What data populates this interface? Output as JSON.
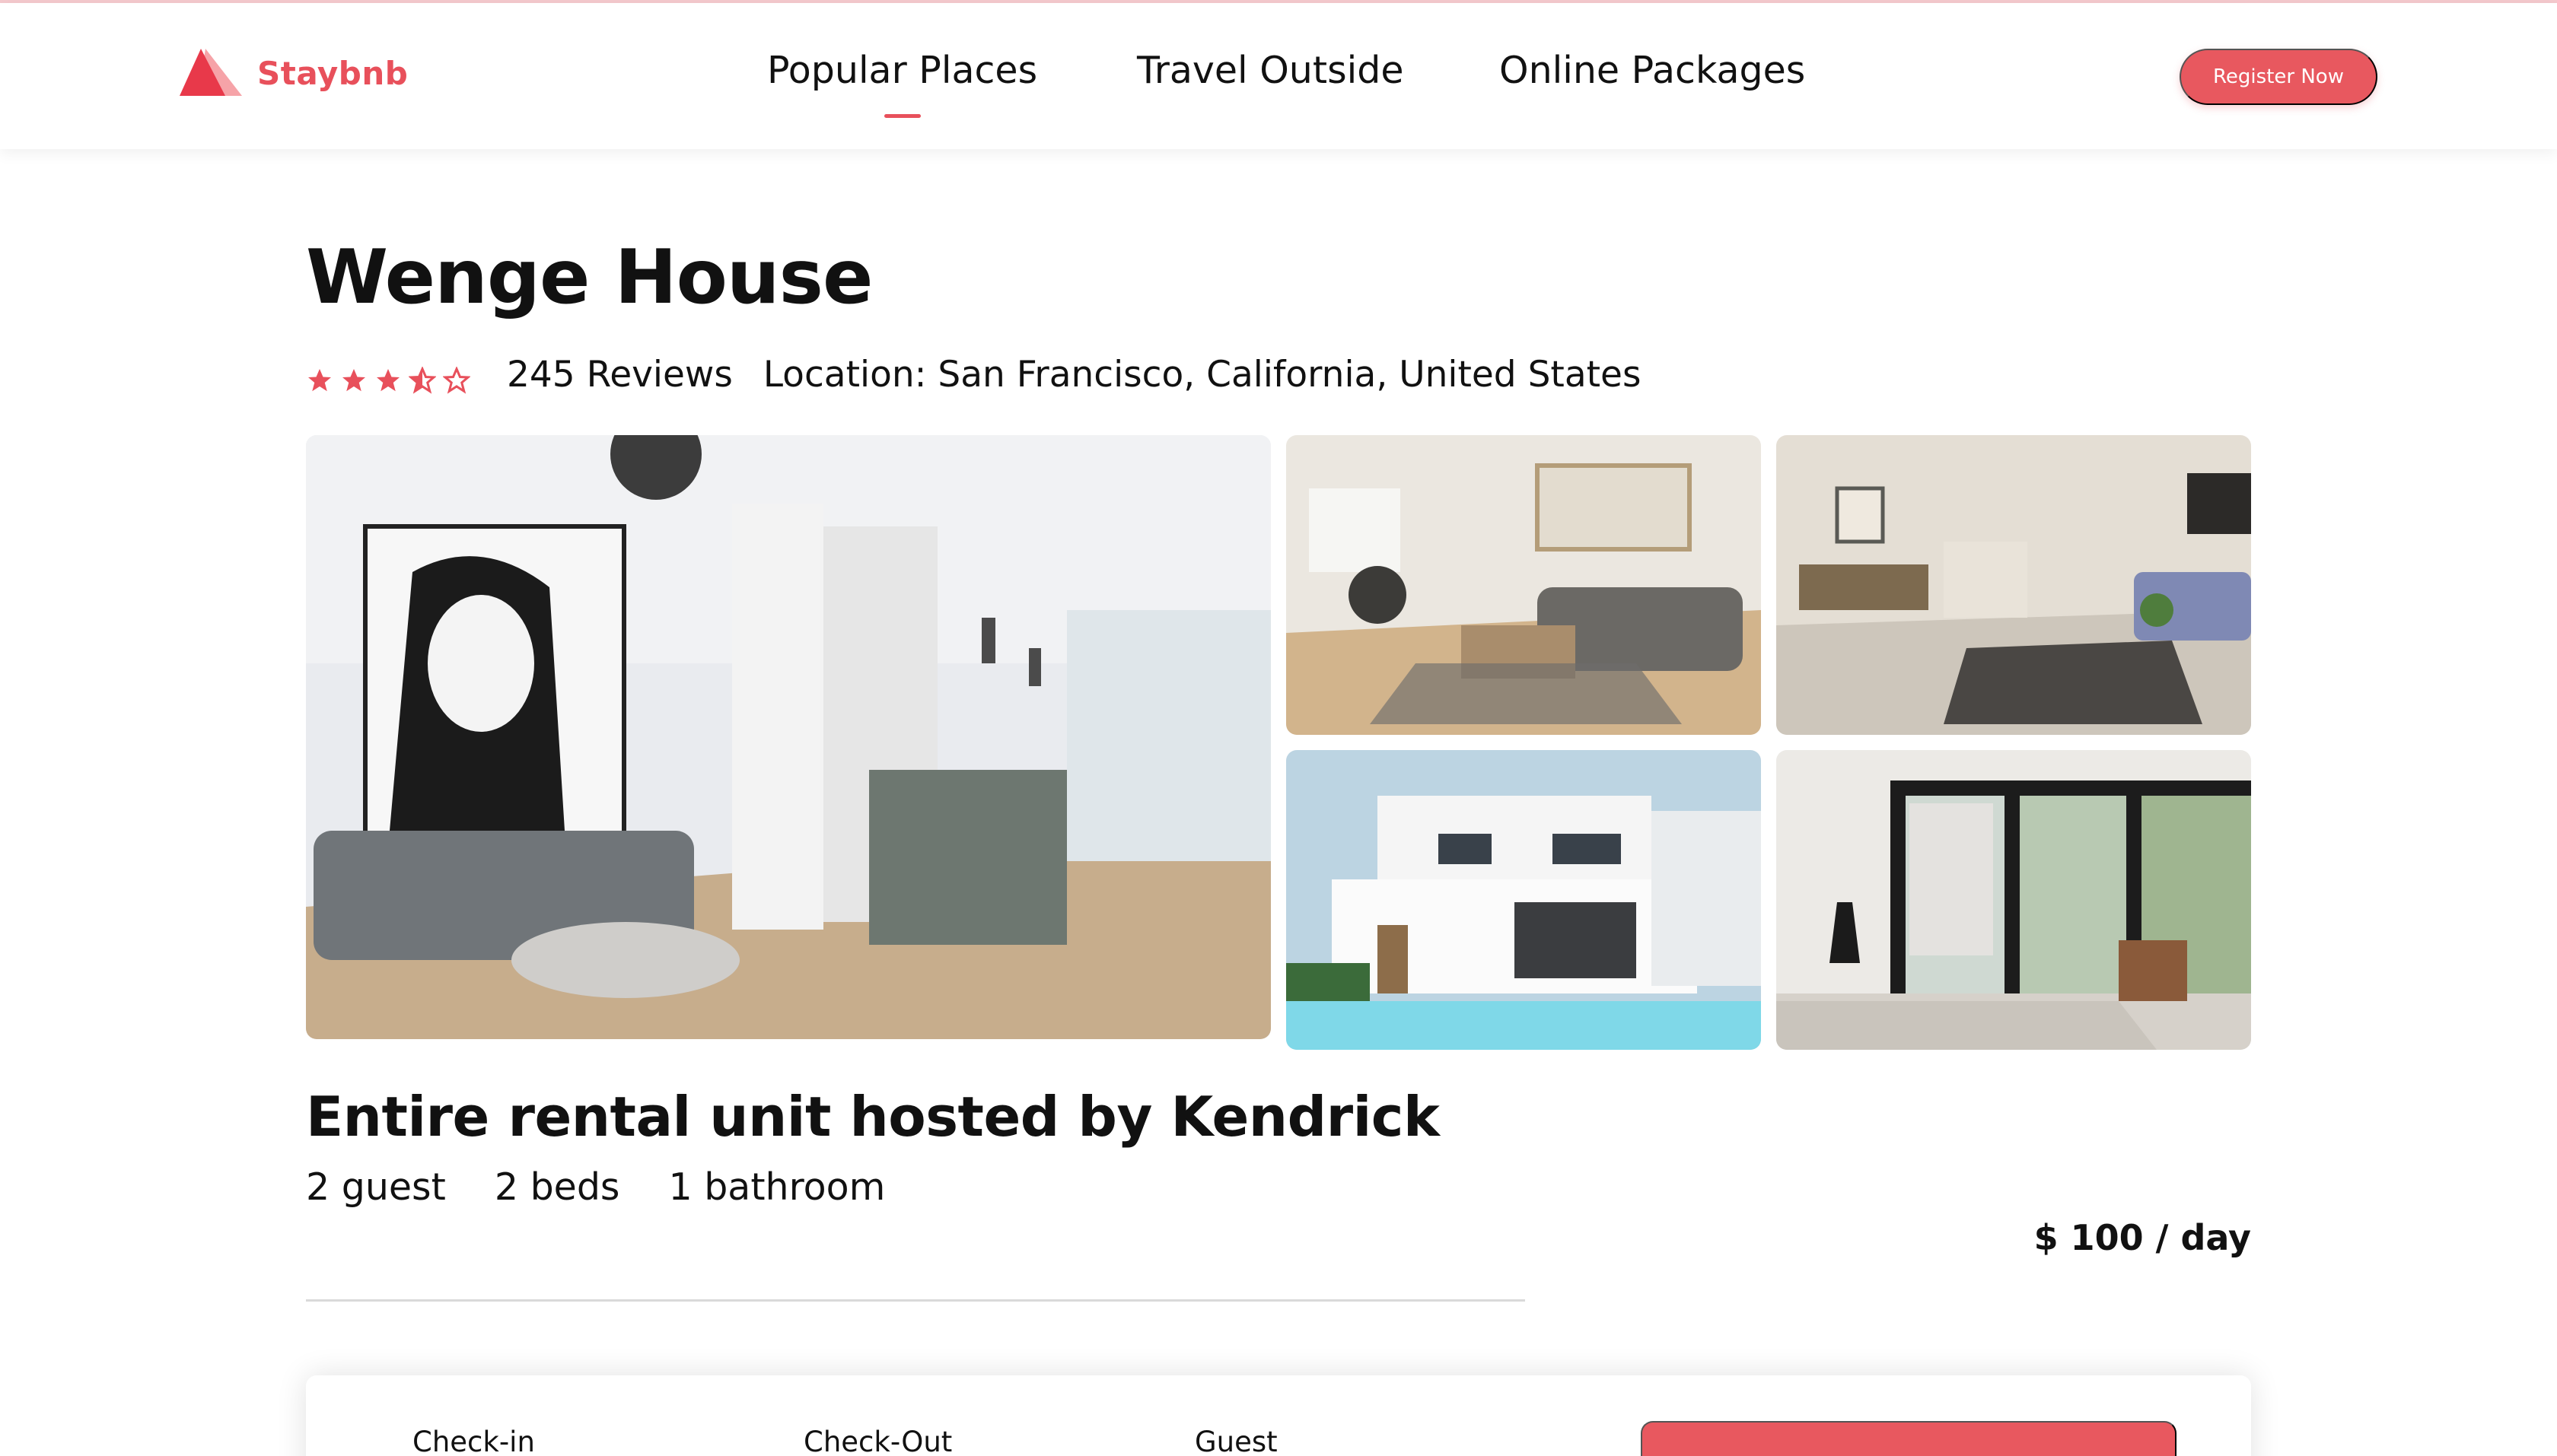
{
  "brand": {
    "name": "Staybnb",
    "color": "#e8505b"
  },
  "nav": {
    "items": [
      {
        "label": "Popular Places",
        "active": true
      },
      {
        "label": "Travel Outside",
        "active": false
      },
      {
        "label": "Online Packages",
        "active": false
      }
    ],
    "register_label": "Register Now"
  },
  "listing": {
    "title": "Wenge House",
    "rating": 3.5,
    "rating_max": 5,
    "reviews": "245 Reviews",
    "location": "Location: San Francisco, California, United States",
    "host_line": "Entire rental unit hosted by Kendrick",
    "specs": [
      "2 guest",
      "2 beds",
      "1 bathroom"
    ],
    "price": "$ 100 / day"
  },
  "gallery": {
    "images": [
      {
        "name": "living-room-kitchen-photo"
      },
      {
        "name": "living-room-dining-photo"
      },
      {
        "name": "lounge-area-photo"
      },
      {
        "name": "villa-pool-photo"
      },
      {
        "name": "bedroom-window-photo"
      }
    ]
  },
  "booking": {
    "checkin_label": "Check-in",
    "checkout_label": "Check-Out",
    "guest_label": "Guest",
    "button_label": ""
  }
}
